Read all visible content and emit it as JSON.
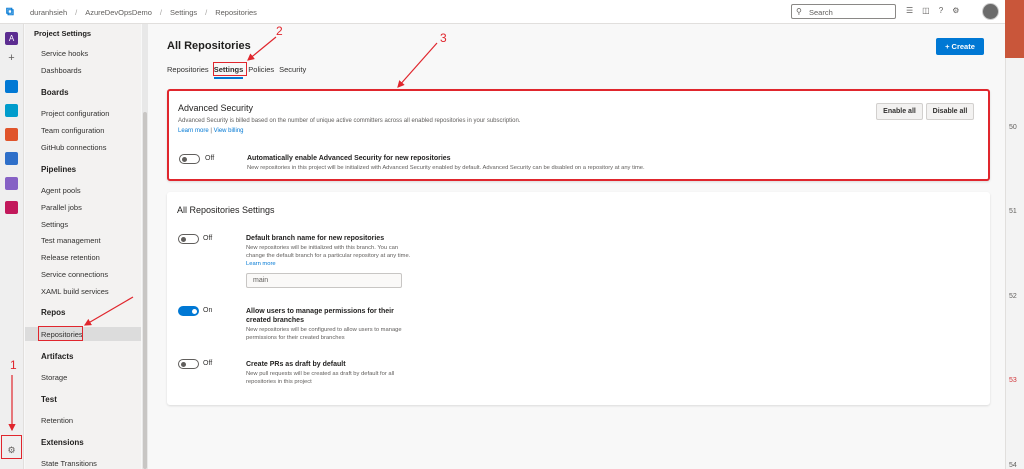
{
  "breadcrumb": [
    "duranhsieh",
    "AzureDevOpsDemo",
    "Settings",
    "Repositories"
  ],
  "search": {
    "placeholder": "Search"
  },
  "sidebar": {
    "title": "Project Settings",
    "items": [
      {
        "label": "Service hooks"
      },
      {
        "label": "Dashboards"
      }
    ],
    "boards": {
      "head": "Boards",
      "items": [
        "Project configuration",
        "Team configuration",
        "GitHub connections"
      ]
    },
    "pipelines": {
      "head": "Pipelines",
      "items": [
        "Agent pools",
        "Parallel jobs",
        "Settings",
        "Test management",
        "Release retention",
        "Service connections",
        "XAML build services"
      ]
    },
    "repos": {
      "head": "Repos",
      "items": [
        "Repositories"
      ]
    },
    "artifacts": {
      "head": "Artifacts",
      "items": [
        "Storage"
      ]
    },
    "test": {
      "head": "Test",
      "items": [
        "Retention"
      ]
    },
    "extensions": {
      "head": "Extensions",
      "items": [
        "State Transitions"
      ]
    }
  },
  "main": {
    "title": "All Repositories",
    "tabs": [
      "Repositories",
      "Settings",
      "Policies",
      "Security"
    ],
    "create_label": "Create",
    "advanced": {
      "title": "Advanced Security",
      "desc": "Advanced Security is billed based on the number of unique active committers across all enabled repositories in your subscription.",
      "learn_more": "Learn more",
      "sep": "|",
      "view_billing": "View billing",
      "enable_all": "Enable all",
      "disable_all": "Disable all",
      "toggle_label": "Off",
      "opt_title": "Automatically enable Advanced Security for new repositories",
      "opt_desc": "New repositories in this project will be initialized with Advanced Security enabled by default. Advanced Security can be disabled on a repository at any time."
    },
    "settings": {
      "title": "All Repositories Settings",
      "opt1": {
        "toggle_label": "Off",
        "title": "Default branch name for new repositories",
        "desc": "New repositories will be initialized with this branch. You can change the default branch for a particular repository at any time.",
        "learn_more": "Learn more",
        "value": "main"
      },
      "opt2": {
        "toggle_label": "On",
        "title": "Allow users to manage permissions for their created branches",
        "desc": "New repositories will be configured to allow users to manage permissions for their created branches"
      },
      "opt3": {
        "toggle_label": "Off",
        "title": "Create PRs as draft by default",
        "desc": "New pull requests will be created as draft by default for all repositories in this project"
      }
    }
  },
  "right_strip": [
    "50",
    "51",
    "52",
    "53",
    "54"
  ],
  "annotations": [
    "1",
    "2",
    "3"
  ],
  "colors": {
    "accent": "#0078d4",
    "annotation": "#e0262d"
  }
}
